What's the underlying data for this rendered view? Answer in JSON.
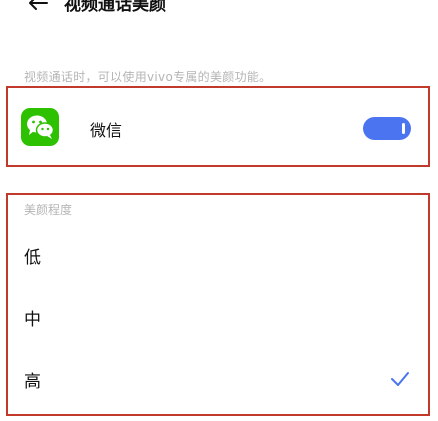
{
  "header": {
    "title": "视频通话美颜"
  },
  "hint": "视频通话时，可以使用vivo专属的美颜功能。",
  "app": {
    "name": "微信",
    "icon": "wechat-icon",
    "enabled": true
  },
  "beauty_level": {
    "title": "美颜程度",
    "options": [
      {
        "label": "低",
        "selected": false
      },
      {
        "label": "中",
        "selected": false
      },
      {
        "label": "高",
        "selected": true
      }
    ]
  },
  "colors": {
    "accent": "#4a74f0",
    "highlight_border": "#c0392b",
    "wechat_green": "#2dc100"
  }
}
